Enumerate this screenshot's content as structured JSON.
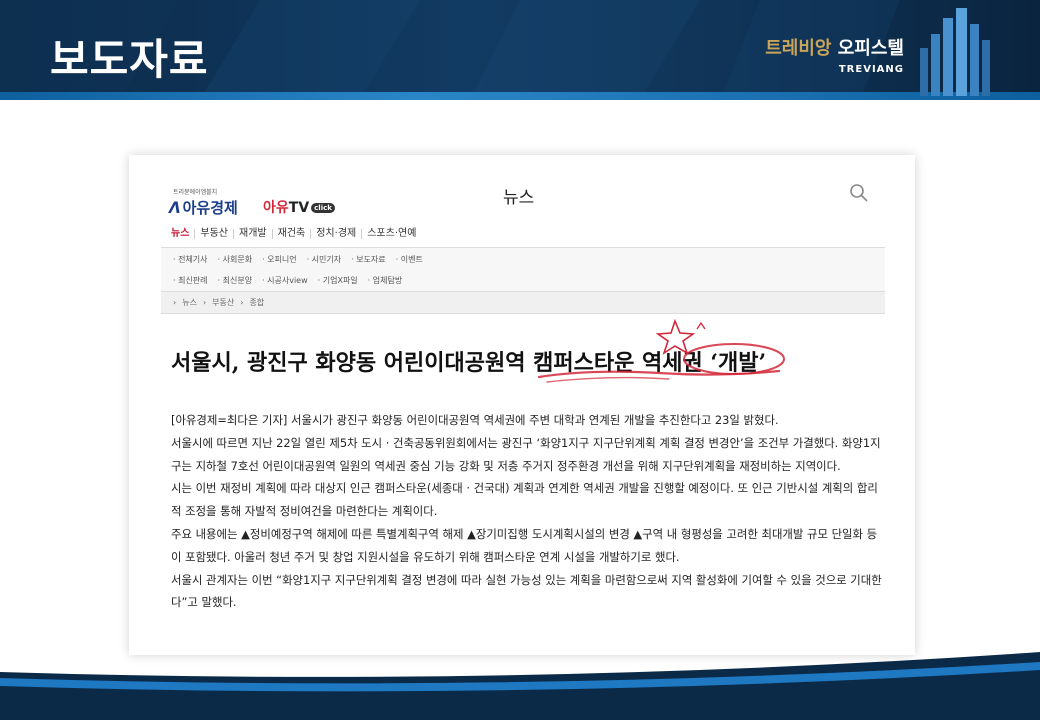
{
  "slide": {
    "title": "보도자료",
    "brand_gold": "트레비앙",
    "brand_white": "오피스텔",
    "brand_sub": "TREVIANG"
  },
  "site": {
    "logo_small": "트리뷴에이엠블치",
    "logo_name": "아유경제",
    "logo_tv_a": "아유",
    "logo_tv_b": "TV",
    "logo_click": "click",
    "section": "뉴스",
    "search_icon": "search-icon",
    "nav_main": [
      "뉴스",
      "부동산",
      "재개발",
      "재건축",
      "정치·경제",
      "스포츠·연예"
    ],
    "nav_sub_1": [
      "· 전체기사",
      "· 사회문화",
      "· 오피니언",
      "· 시민기자",
      "· 보도자료",
      "· 이벤트"
    ],
    "nav_sub_2": [
      "· 최신판례",
      "· 최신분양",
      "· 시공사view",
      "· 기업X파일",
      "· 업체탐방"
    ],
    "breadcrumb": [
      "›",
      "뉴스",
      "›",
      "부동산",
      "›",
      "종합"
    ]
  },
  "article": {
    "headline": "서울시, 광진구 화양동 어린이대공원역 캠퍼스타운 역세권 ‘개발’",
    "paragraphs": [
      "[아유경제=최다은 기자] 서울시가 광진구 화양동 어린이대공원역 역세권에 주변 대학과 연계된 개발을 추진한다고 23일 밝혔다.",
      "서울시에 따르면 지난 22일 열린 제5차 도시 · 건축공동위원회에서는 광진구 ‘화양1지구 지구단위계획 계획 결정 변경안’을 조건부 가결했다. 화양1지구는 지하철 7호선 어린이대공원역 일원의 역세권 중심 기능 강화 및 저층 주거지 정주환경 개선을 위해 지구단위계획을 재정비하는 지역이다.",
      "시는 이번 재정비 계획에 따라 대상지 인근 캠퍼스타운(세종대 · 건국대) 계획과 연계한 역세권 개발을 진행할 예정이다. 또 인근 기반시설 계획의 합리적 조정을 통해 자발적 정비여건을 마련한다는 계획이다.",
      "주요 내용에는 ▲정비예정구역 해제에 따른 특별계획구역 해제 ▲장기미집행 도시계획시설의 변경 ▲구역 내 형평성을 고려한 최대개발 규모 단일화 등이 포함됐다. 아울러 청년 주거 및 창업 지원시설을 유도하기 위해 캠퍼스타운 연계 시설을 개발하기로 했다.",
      "서울시 관계자는 이번 “화양1지구 지구단위계획 결정 변경에 따라 실현 가능성 있는 계획을 마련함으로써 지역 활성화에 기여할 수 있을 것으로 기대한다”고 말했다."
    ]
  },
  "colors": {
    "header_bg": "#0b2a48",
    "accent_blue": "#1e78c2",
    "brand_gold": "#c9a45b",
    "annotation_red": "#d3283a"
  }
}
